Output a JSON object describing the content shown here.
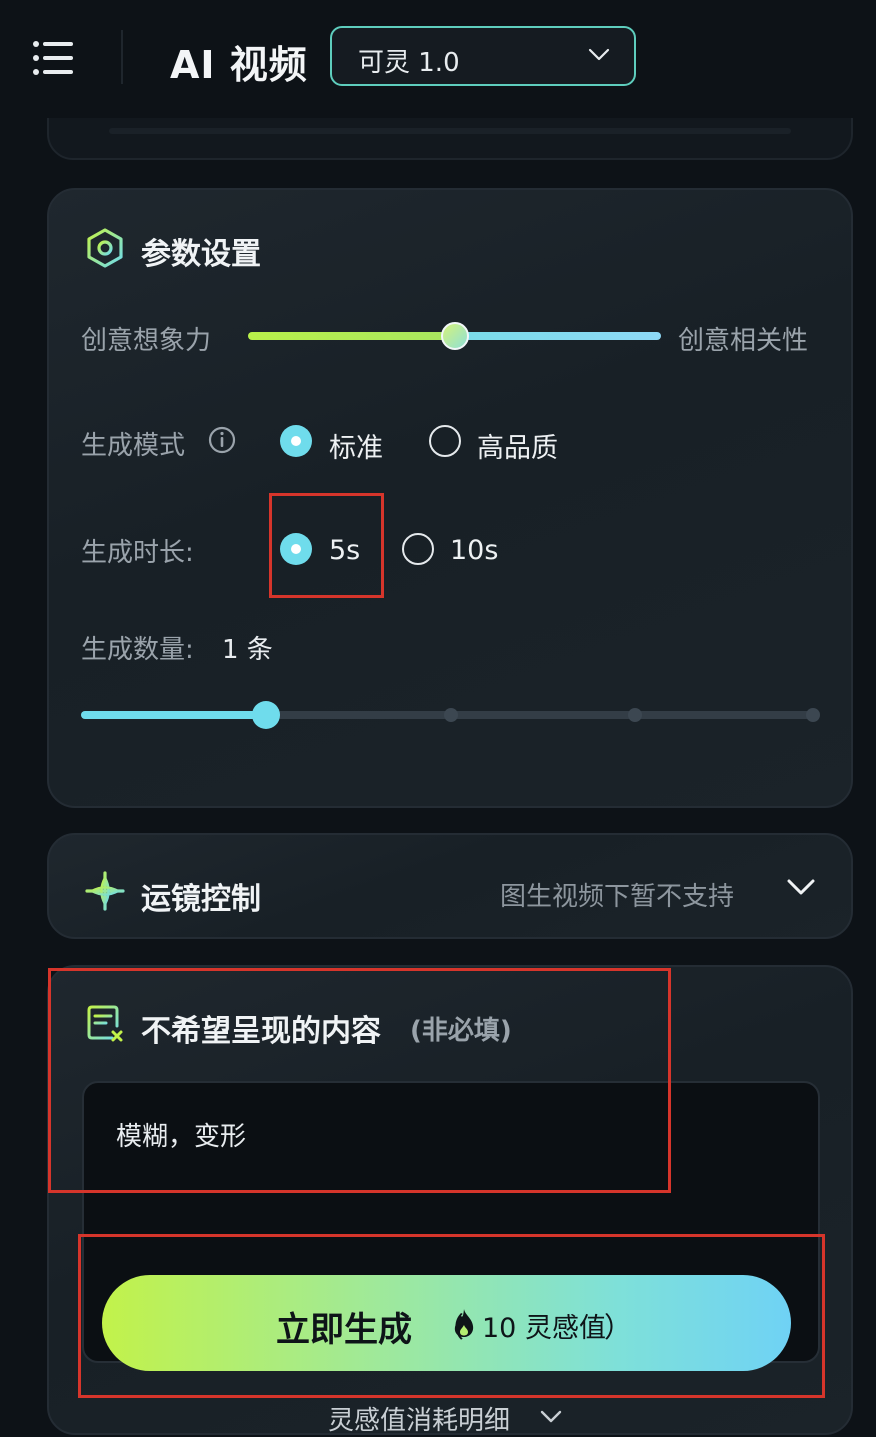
{
  "header": {
    "title": "AI 视频",
    "model_select": {
      "value": "可灵 1.0"
    }
  },
  "params": {
    "title": "参数设置",
    "creativity": {
      "left_label": "创意想象力",
      "right_label": "创意相关性",
      "value": 0.5
    },
    "mode": {
      "label": "生成模式",
      "options": [
        {
          "label": "标准",
          "selected": true
        },
        {
          "label": "高品质",
          "selected": false
        }
      ]
    },
    "duration": {
      "label": "生成时长:",
      "options": [
        {
          "label": "5s",
          "selected": true
        },
        {
          "label": "10s",
          "selected": false
        }
      ]
    },
    "count": {
      "label": "生成数量:",
      "value": "1 条",
      "steps": 5,
      "current_step": 1
    }
  },
  "camera": {
    "title": "运镜控制",
    "note": "图生视频下暂不支持"
  },
  "negative": {
    "title": "不希望呈现的内容",
    "optional": "(非必填)",
    "value": "模糊，变形"
  },
  "generate": {
    "label": "立即生成",
    "paren_open": "（",
    "cost": "10 灵感值",
    "paren_close": "）"
  },
  "footer": {
    "link": "灵感值消耗明细"
  },
  "colors": {
    "accent": "#6fdcec",
    "lime": "#c2f24a",
    "annotation": "#d6352b"
  }
}
